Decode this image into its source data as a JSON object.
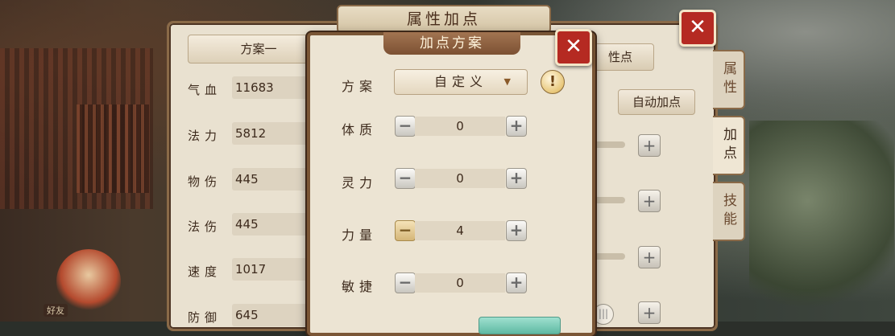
{
  "window": {
    "title": "属性加点"
  },
  "scheme_tab": {
    "label": "方案一"
  },
  "main_buttons": {
    "partial_label": "性点",
    "auto_label": "自动加点"
  },
  "attributes": [
    {
      "label": "气血",
      "value": "11683"
    },
    {
      "label": "法力",
      "value": "5812"
    },
    {
      "label": "物伤",
      "value": "445"
    },
    {
      "label": "法伤",
      "value": "445"
    },
    {
      "label": "速度",
      "value": "1017"
    },
    {
      "label": "防御",
      "value": "645"
    }
  ],
  "side_tabs": [
    {
      "label": "属性"
    },
    {
      "label": "加点"
    },
    {
      "label": "技能"
    }
  ],
  "dialog": {
    "title": "加点方案",
    "scheme_label": "方案",
    "scheme_value": "自定义",
    "info_icon": "!",
    "close_icon": "✕",
    "rows": [
      {
        "label": "体质",
        "value": "0"
      },
      {
        "label": "灵力",
        "value": "0"
      },
      {
        "label": "力量",
        "value": "4"
      },
      {
        "label": "敏捷",
        "value": "0"
      }
    ]
  },
  "icons": {
    "minus": "−",
    "plus": "+",
    "caret": "▼"
  },
  "pet_label": "好友",
  "colors": {
    "accent_red": "#b52a22",
    "frame_brown": "#7a5636",
    "panel_beige": "#ece4d3"
  }
}
